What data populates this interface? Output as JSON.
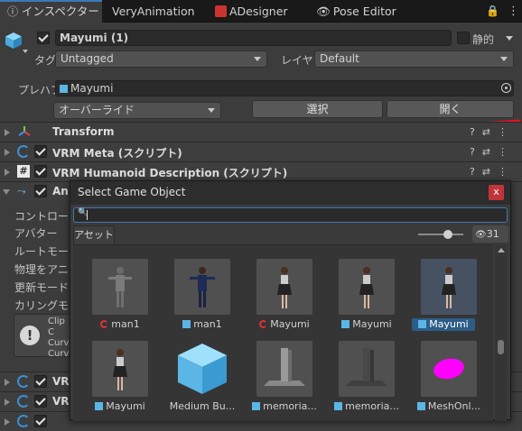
{
  "tabs": {
    "inspector": "インスペクター",
    "very_animation": "VeryAnimation",
    "adesigner": "ADesigner",
    "pose_editor": "Pose Editor"
  },
  "object": {
    "name": "Mayumi (1)",
    "static_label": "静的",
    "tag_label": "タグ",
    "tag_value": "Untagged",
    "layer_label": "レイヤー",
    "layer_value": "Default",
    "prefab_label": "プレハブ",
    "prefab_value": "Mayumi",
    "overrides_label": "オーバーライド",
    "select_button": "選択",
    "open_button": "開く"
  },
  "components": {
    "transform": "Transform",
    "vrm_meta": "VRM Meta (スクリプト)",
    "vrm_humanoid": "VRM Humanoid Description (スクリプト)",
    "animator_partial": "An",
    "bottom_partial": "VR"
  },
  "animator_rows": {
    "controller": "コントローラー",
    "avatar": "アバター",
    "root_motion": "ルートモーション",
    "physics": "物理をアニメ",
    "update_mode": "更新モード",
    "culling_mode": "カリングモード",
    "info_line1": "Clip C",
    "info_line2": "Curv",
    "info_line3": "Curv"
  },
  "picker": {
    "title": "Select Game Object",
    "close_label": "x",
    "search_value": "",
    "tab_assets": "アセット",
    "visible_count": "31",
    "items": [
      {
        "name": "man1",
        "icon": "model-icon",
        "selected": false
      },
      {
        "name": "man1",
        "icon": "prefab-icon",
        "selected": false
      },
      {
        "name": "Mayumi",
        "icon": "model-icon",
        "selected": false
      },
      {
        "name": "Mayumi",
        "icon": "prefab-icon",
        "selected": false
      },
      {
        "name": "Mayumi",
        "icon": "prefab-icon",
        "selected": true
      },
      {
        "name": "Mayumi",
        "icon": "prefab-icon",
        "selected": false
      },
      {
        "name": "Medium Bu...",
        "icon": "none",
        "selected": false
      },
      {
        "name": "memoria...",
        "icon": "prefab-icon",
        "selected": false
      },
      {
        "name": "memoria...",
        "icon": "prefab-icon",
        "selected": false
      },
      {
        "name": "MeshOnl...",
        "icon": "prefab-icon",
        "selected": false
      }
    ]
  },
  "colors": {
    "accent_blue": "#3a79bb",
    "prefab_blue": "#5bb6e6",
    "close_red": "#c2343b",
    "selection": "#2c5d87",
    "annotation_red": "#e8101e",
    "magenta_mesh": "#ff00ff"
  }
}
